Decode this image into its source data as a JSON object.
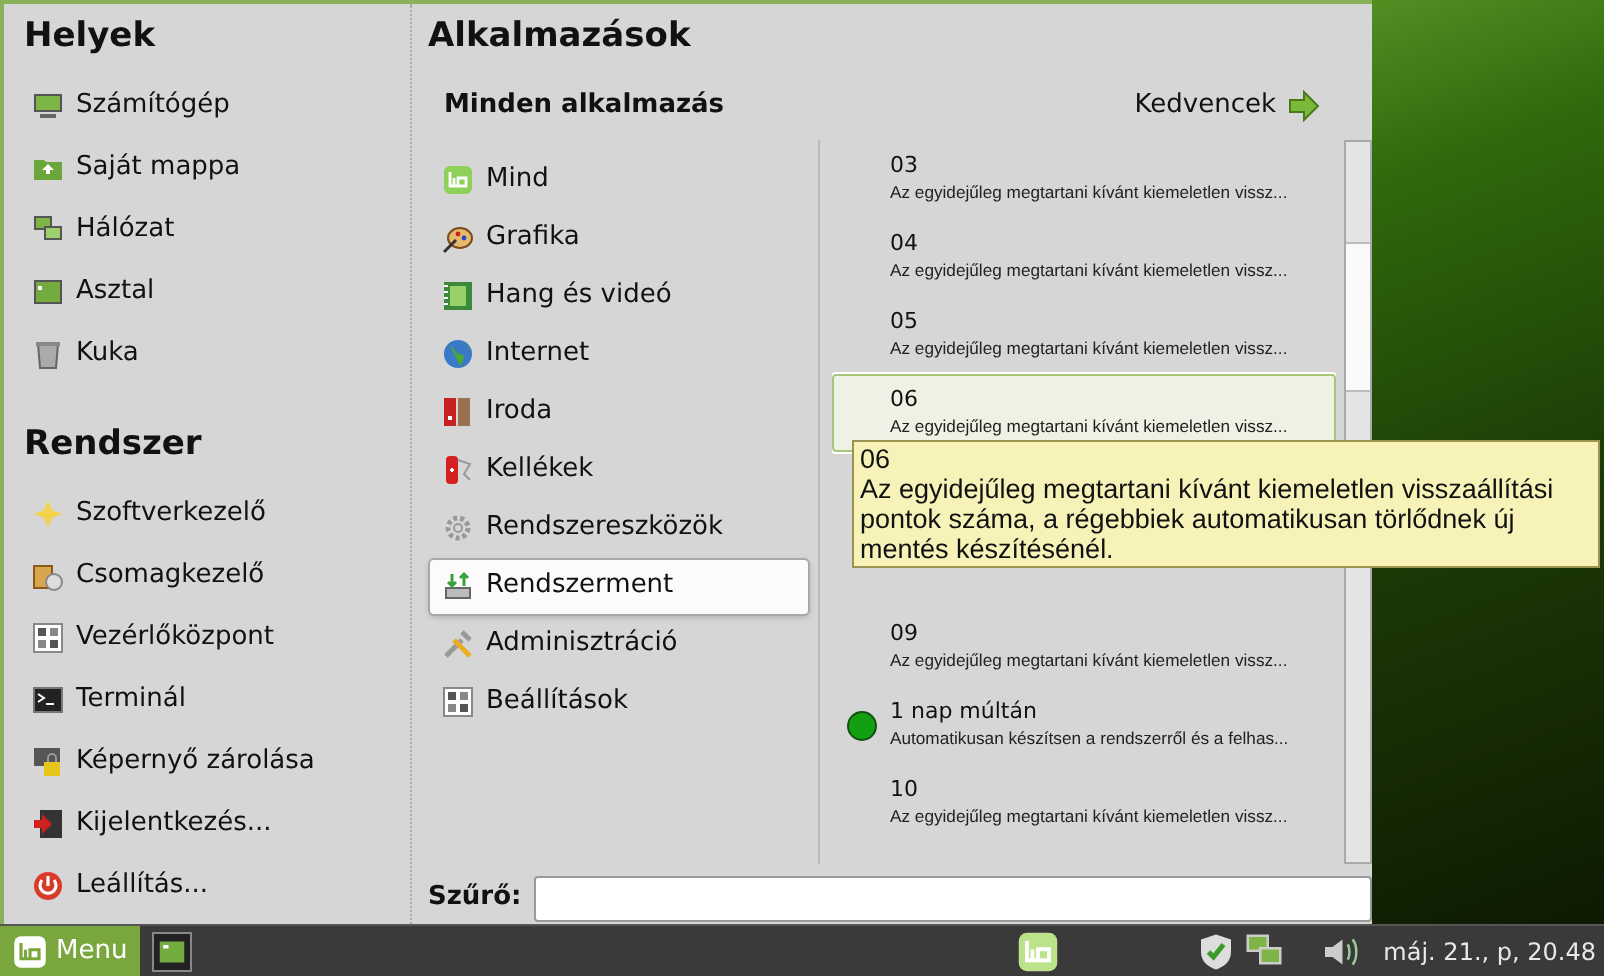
{
  "places": {
    "heading": "Helyek",
    "items": [
      "Számítógép",
      "Saját mappa",
      "Hálózat",
      "Asztal",
      "Kuka"
    ]
  },
  "system": {
    "heading": "Rendszer",
    "items": [
      "Szoftverkezelő",
      "Csomagkezelő",
      "Vezérlőközpont",
      "Terminál",
      "Képernyő zárolása",
      "Kijelentkezés...",
      "Leállítás..."
    ]
  },
  "applications": {
    "heading": "Alkalmazások",
    "subheading": "Minden alkalmazás",
    "favorites": "Kedvencek",
    "categories": [
      {
        "label": "Mind",
        "selected": false
      },
      {
        "label": "Grafika",
        "selected": false
      },
      {
        "label": "Hang és videó",
        "selected": false
      },
      {
        "label": "Internet",
        "selected": false
      },
      {
        "label": "Iroda",
        "selected": false
      },
      {
        "label": "Kellékek",
        "selected": false
      },
      {
        "label": "Rendszereszközök",
        "selected": false
      },
      {
        "label": "Rendszerment",
        "selected": true
      },
      {
        "label": "Adminisztráció",
        "selected": false
      },
      {
        "label": "Beállítások",
        "selected": false
      }
    ],
    "items": [
      {
        "kind": "setting",
        "title": "03",
        "description": "Az egyidejűleg megtartani kívánt kiemeletlen vissz...",
        "hovered": false
      },
      {
        "kind": "setting",
        "title": "04",
        "description": "Az egyidejűleg megtartani kívánt kiemeletlen vissz...",
        "hovered": false
      },
      {
        "kind": "setting",
        "title": "05",
        "description": "Az egyidejűleg megtartani kívánt kiemeletlen vissz...",
        "hovered": false
      },
      {
        "kind": "setting",
        "title": "06",
        "description": "Az egyidejűleg megtartani kívánt kiemeletlen vissz...",
        "hovered": true
      },
      {
        "kind": "hidden",
        "hovered": false
      },
      {
        "kind": "hidden",
        "hovered": false
      },
      {
        "kind": "setting",
        "title": "09",
        "description": "Az egyidejűleg megtartani kívánt kiemeletlen vissz...",
        "hovered": false
      },
      {
        "kind": "point",
        "title": "1 nap múltán",
        "description": "Automatikusan készítsen a rendszerről és a felhas...",
        "hovered": false
      },
      {
        "kind": "setting",
        "title": "10",
        "description": "Az egyidejűleg megtartani kívánt kiemeletlen vissz...",
        "hovered": false
      }
    ],
    "filter_label": "Szűrő:"
  },
  "tooltip": {
    "title": "06",
    "text": "Az egyidejűleg megtartani kívánt kiemeletlen visszaállítási pontok száma, a régebbiek automatikusan törlődnek új mentés készítésénél."
  },
  "taskbar": {
    "menu": "Menu",
    "clock": "máj. 21., p, 20.48"
  }
}
